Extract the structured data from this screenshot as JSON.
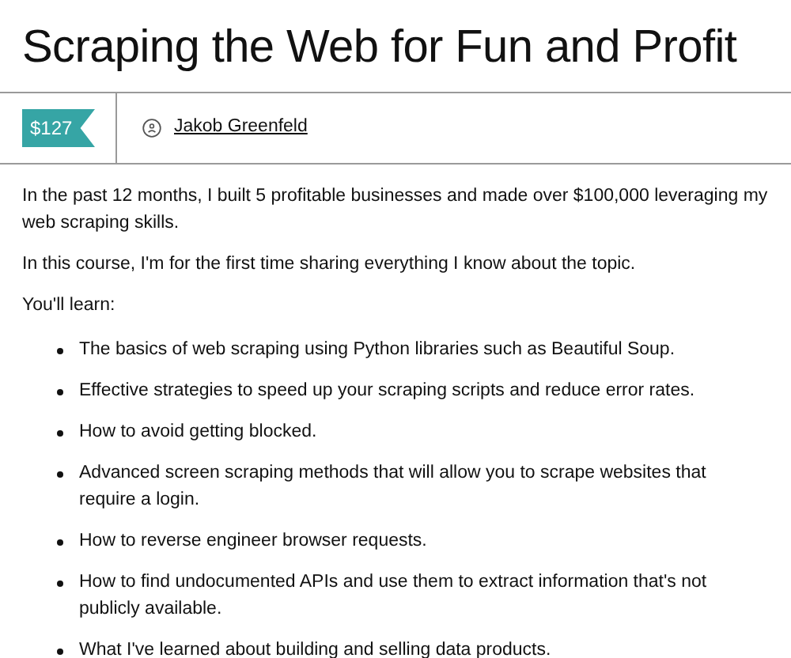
{
  "title": "Scraping the Web for Fun and Profit",
  "price": "$127",
  "author": "Jakob Greenfeld",
  "paragraphs": [
    "In the past 12 months, I built 5 profitable businesses and made over $100,000 leveraging my web scraping skills.",
    "In this course, I'm for the first time sharing everything I know about the topic.",
    "You'll learn:"
  ],
  "bullets": [
    "The basics of web scraping using Python libraries such as Beautiful Soup.",
    "Effective strategies to speed up your scraping scripts and reduce error rates.",
    "How to avoid getting blocked.",
    "Advanced screen scraping methods that will allow you to scrape websites that require a login.",
    "How to reverse engineer browser requests.",
    "How to find undocumented APIs and use them to extract information that's not publicly available.",
    "What I've learned about building and selling data products."
  ]
}
